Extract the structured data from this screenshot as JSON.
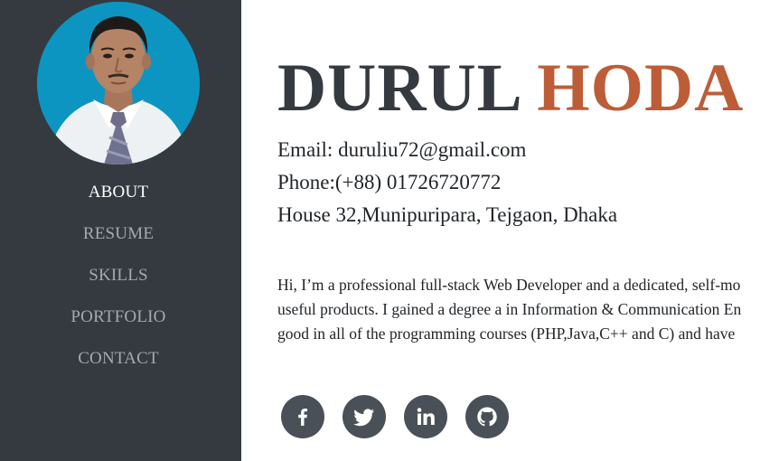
{
  "profile": {
    "first_name": "DURUL",
    "last_name": "HODA",
    "email": "Email: duruliu72@gmail.com",
    "phone": "Phone:(+88) 01726720772",
    "address": "House 32,Munipuripara, Tejgaon, Dhaka",
    "bio_lines": [
      "Hi, I’m a professional full-stack Web Developer and a dedicated, self-mo",
      "useful products. I gained a degree a in Information & Communication En",
      "good in all of the programming courses (PHP,Java,C++ and C) and have"
    ]
  },
  "sidebar": {
    "items": [
      {
        "label": "ABOUT",
        "active": true
      },
      {
        "label": "RESUME",
        "active": false
      },
      {
        "label": "SKILLS",
        "active": false
      },
      {
        "label": "PORTFOLIO",
        "active": false
      },
      {
        "label": "CONTACT",
        "active": false
      }
    ]
  },
  "social": {
    "icons": [
      "facebook-icon",
      "twitter-icon",
      "linkedin-icon",
      "github-icon"
    ]
  },
  "colors": {
    "sidebar_bg": "#343a40",
    "accent": "#bd5d38",
    "avatar_bg": "#0d95c2",
    "social_bg": "#495057"
  }
}
